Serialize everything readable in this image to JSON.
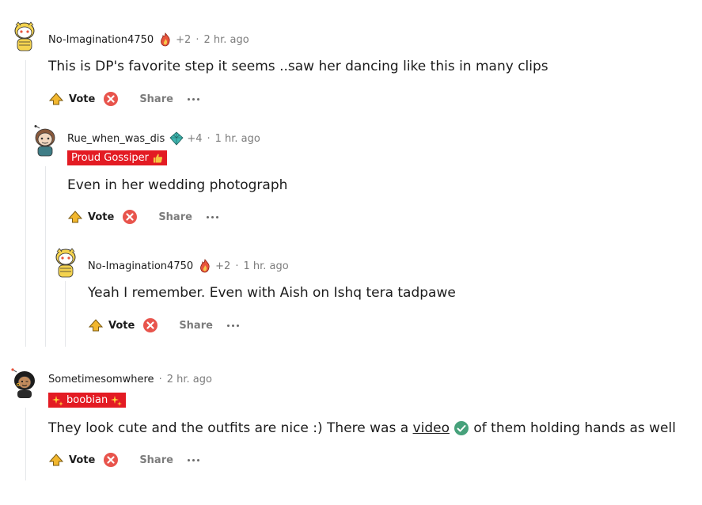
{
  "comments": [
    {
      "username": "No-Imagination4750",
      "award_count": "+2",
      "time": "2 hr. ago",
      "body": "This is DP's favorite step it seems ..saw her dancing like this in many clips",
      "vote_label": "Vote",
      "share_label": "Share"
    },
    {
      "username": "Rue_when_was_dis",
      "award_count": "+4",
      "time": "1 hr. ago",
      "flair": "Proud Gossiper",
      "body": "Even in her wedding photograph",
      "vote_label": "Vote",
      "share_label": "Share"
    },
    {
      "username": "No-Imagination4750",
      "award_count": "+2",
      "time": "1 hr. ago",
      "body": "Yeah I remember. Even with Aish on Ishq tera tadpawe",
      "vote_label": "Vote",
      "share_label": "Share"
    },
    {
      "username": "Sometimesomwhere",
      "time": "2 hr. ago",
      "flair": "boobian",
      "body_before": "They look cute and the outfits are nice :) There was a ",
      "body_link": "video",
      "body_after": " of them holding hands as well",
      "vote_label": "Vote",
      "share_label": "Share"
    }
  ],
  "separator": "·",
  "colors": {
    "flair_bg": "#e31b23",
    "upvote": "#f2b72e",
    "downvote": "#e8544c",
    "verified": "#46a17b"
  },
  "icons": {
    "upvote": "upvote-icon",
    "downvote": "downvote-icon",
    "more": "more-options-icon",
    "award_fire": "fire-award-icon",
    "award_gem": "gem-award-icon",
    "verified": "check-badge-icon"
  }
}
